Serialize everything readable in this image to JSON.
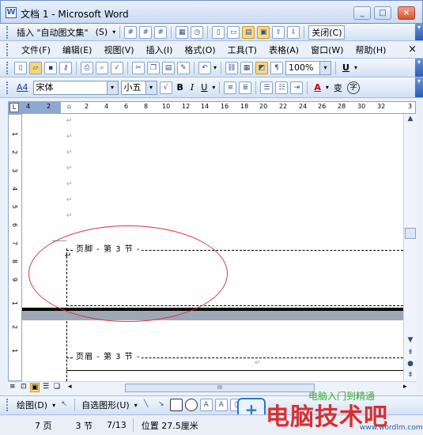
{
  "window": {
    "title": "文档 1 - Microsoft Word",
    "app_icon": "W",
    "controls": [
      "_",
      "□",
      "×"
    ]
  },
  "hf_toolbar": {
    "insert_autotext": "插入 \"自动图文集\"",
    "autotext_shortcut": "(S)",
    "close_button": "关闭(C)"
  },
  "menu": {
    "items": [
      "文件(F)",
      "编辑(E)",
      "视图(V)",
      "插入(I)",
      "格式(O)",
      "工具(T)",
      "表格(A)",
      "窗口(W)",
      "帮助(H)"
    ],
    "close_glyph": "×"
  },
  "standard_toolbar": {
    "zoom": "100%",
    "underline_label": "U"
  },
  "format_toolbar": {
    "style_marker": "A4",
    "font_name": "宋体",
    "font_size": "小五",
    "bold": "B",
    "italic": "I",
    "underline": "U",
    "font_color": "A",
    "wen": "变",
    "circle": "字"
  },
  "ruler": {
    "corner": "L",
    "ticks": [
      "4",
      "2",
      "2",
      "4",
      "6",
      "8",
      "10",
      "12",
      "14",
      "16",
      "18",
      "20",
      "22",
      "24",
      "26",
      "28",
      "30",
      "32",
      "3"
    ]
  },
  "vertical_ruler": {
    "ticks": [
      "1",
      "2",
      "3",
      "4",
      "5",
      "6",
      "7",
      "8",
      "9",
      "1",
      "2",
      "1"
    ]
  },
  "document": {
    "paragraph_mark": "↵",
    "footer_label": "页脚 - 第 3 节 -",
    "header_label": "页眉 - 第 3 节 -",
    "footer_mark": "↵"
  },
  "view_bar": {
    "scroll_marker": "III"
  },
  "draw_toolbar": {
    "draw": "绘图(D)",
    "autoshapes": "自选图形(U)"
  },
  "status": {
    "page": "7 页",
    "section": "3 节",
    "page_of": "7/13",
    "position": "位置 27.5厘米"
  },
  "watermark": {
    "title": "电脑入门到精通",
    "brand": "电脑技术吧",
    "url": "www.wordlm.com",
    "logo": "+"
  },
  "colors": {
    "annotation_ellipse": "#d43a3a",
    "toolbar_bg": "#d3e1f5",
    "page_bg": "#ffffff"
  }
}
